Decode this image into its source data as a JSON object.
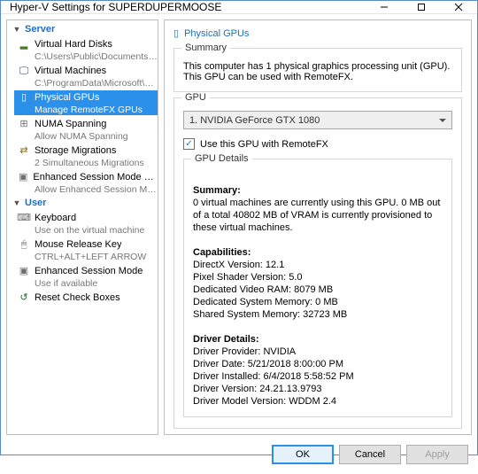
{
  "window": {
    "title": "Hyper-V Settings for SUPERDUPERMOOSE"
  },
  "tree": {
    "server_section": "Server",
    "user_section": "User",
    "items": {
      "vhd": {
        "label": "Virtual Hard Disks",
        "sub": "C:\\Users\\Public\\Documents\\Hyper-..."
      },
      "vm": {
        "label": "Virtual Machines",
        "sub": "C:\\ProgramData\\Microsoft\\Windo..."
      },
      "gpu": {
        "label": "Physical GPUs",
        "sub": "Manage RemoteFX GPUs"
      },
      "numa": {
        "label": "NUMA Spanning",
        "sub": "Allow NUMA Spanning"
      },
      "storage": {
        "label": "Storage Migrations",
        "sub": "2 Simultaneous Migrations"
      },
      "policy": {
        "label": "Enhanced Session Mode Policy",
        "sub": "Allow Enhanced Session Mode"
      },
      "keyboard": {
        "label": "Keyboard",
        "sub": "Use on the virtual machine"
      },
      "mouse": {
        "label": "Mouse Release Key",
        "sub": "CTRL+ALT+LEFT ARROW"
      },
      "session": {
        "label": "Enhanced Session Mode",
        "sub": "Use if available"
      },
      "reset": {
        "label": "Reset Check Boxes"
      }
    }
  },
  "content": {
    "title": "Physical GPUs",
    "summary_legend": "Summary",
    "summary_text": "This computer has 1 physical graphics processing unit (GPU). This GPU can be used with RemoteFX.",
    "gpu_legend": "GPU",
    "gpu_selected": "1. NVIDIA GeForce GTX 1080",
    "use_remote_fx": "Use this GPU with RemoteFX",
    "details_legend": "GPU Details",
    "details": {
      "h1": "Summary:",
      "t1": "0 virtual machines are currently using this GPU. 0 MB out of a total 40802 MB of VRAM is currently provisioned to these virtual machines.",
      "h2": "Capabilities:",
      "c1": "DirectX Version: 12.1",
      "c2": "Pixel Shader Version: 5.0",
      "c3": "Dedicated Video RAM: 8079 MB",
      "c4": "Dedicated System Memory: 0 MB",
      "c5": "Shared System Memory: 32723 MB",
      "h3": "Driver Details:",
      "d1": "Driver Provider: NVIDIA",
      "d2": "Driver Date: 5/21/2018 8:00:00 PM",
      "d3": "Driver Installed: 6/4/2018 5:58:52 PM",
      "d4": "Driver Version: 24.21.13.9793",
      "d5": "Driver Model Version: WDDM 2.4"
    }
  },
  "buttons": {
    "ok": "OK",
    "cancel": "Cancel",
    "apply": "Apply"
  }
}
